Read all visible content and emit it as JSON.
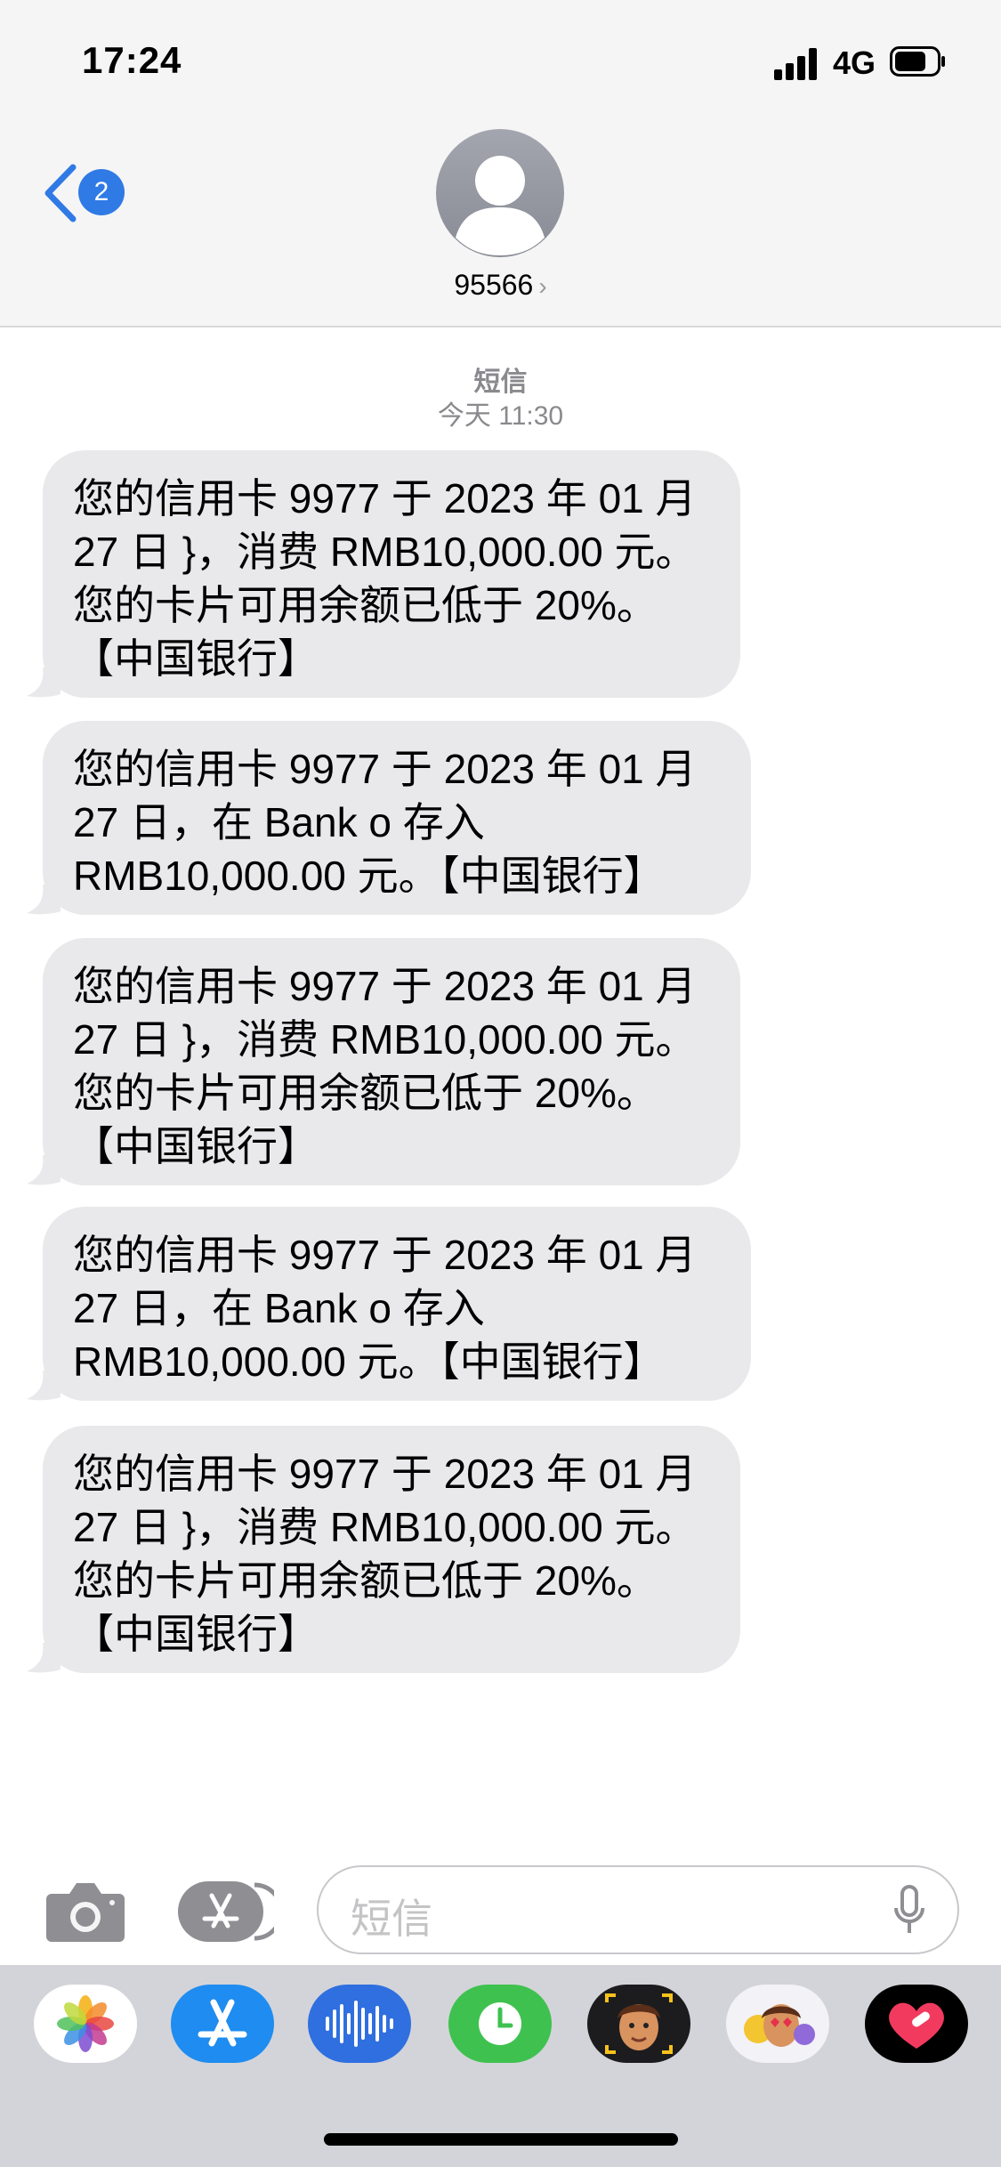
{
  "status_bar": {
    "time": "17:24",
    "network": "4G"
  },
  "nav": {
    "back_badge": "2",
    "contact_name": "95566",
    "contact_chevron": "›"
  },
  "conversation": {
    "service_label": "短信",
    "timestamp": "今天 11:30",
    "messages": [
      "您的信用卡 9977 于 2023 年 01 月\n27 日 }，消费 RMB10,000.00 元。\n您的卡片可用余额已低于 20%。\n【中国银行】",
      "您的信用卡 9977 于 2023 年 01 月\n27 日，在 Bank o 存入\nRMB10,000.00 元。【中国银行】",
      "您的信用卡 9977 于 2023 年 01 月\n27 日 }，消费 RMB10,000.00 元。\n您的卡片可用余额已低于 20%。\n【中国银行】",
      "您的信用卡 9977 于 2023 年 01 月\n27 日，在 Bank o 存入\nRMB10,000.00 元。【中国银行】",
      "您的信用卡 9977 于 2023 年 01 月\n27 日 }，消费 RMB10,000.00 元。\n您的卡片可用余额已低于 20%。\n【中国银行】"
    ]
  },
  "input_bar": {
    "placeholder": "短信"
  },
  "dock_apps": [
    "photos-icon",
    "app-store-icon",
    "audio-messages-icon",
    "digital-touch-icon",
    "memoji-icon",
    "memoji-stickers-icon",
    "fitness-heart-icon"
  ],
  "colors": {
    "accent": "#2f7ae5",
    "bubble": "#e9e9eb",
    "dock": "#d3d4d9"
  }
}
